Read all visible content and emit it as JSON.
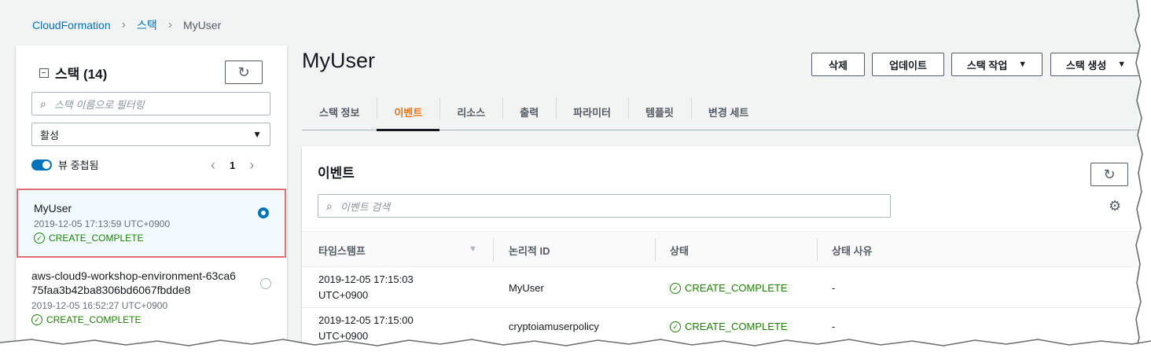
{
  "breadcrumb": {
    "root": "CloudFormation",
    "stacks": "스택",
    "current": "MyUser"
  },
  "left": {
    "title": "스택 (14)",
    "filter_placeholder": "스택 이름으로 필터링",
    "status_filter": "활성",
    "toggle_label": "뷰 중첩됨",
    "page": "1",
    "stacks": [
      {
        "name": "MyUser",
        "time": "2019-12-05 17:13:59 UTC+0900",
        "status": "CREATE_COMPLETE",
        "selected": true
      },
      {
        "name": "aws-cloud9-workshop-environment-63ca675faa3b42ba8306bd6067fbdde8",
        "name_line1": "aws-cloud9-workshop-environment-63ca6",
        "name_line2": "75faa3b42ba8306bd6067fbdde8",
        "time": "2019-12-05 16:52:27 UTC+0900",
        "status": "CREATE_COMPLETE",
        "selected": false
      }
    ]
  },
  "main": {
    "title": "MyUser",
    "buttons": {
      "delete": "삭제",
      "update": "업데이트",
      "stack_actions": "스택 작업",
      "create_stack": "스택 생성"
    },
    "tabs": [
      "스택 정보",
      "이벤트",
      "리소스",
      "출력",
      "파라미터",
      "템플릿",
      "변경 세트"
    ],
    "active_tab": "이벤트",
    "events": {
      "title": "이벤트",
      "search_placeholder": "이벤트 검색",
      "columns": [
        "타임스탬프",
        "논리적 ID",
        "상태",
        "상태 사유"
      ],
      "rows": [
        {
          "ts_line1": "2019-12-05 17:15:03",
          "ts_line2": "UTC+0900",
          "logical_id": "MyUser",
          "status": "CREATE_COMPLETE",
          "reason": "-"
        },
        {
          "ts_line1": "2019-12-05 17:15:00",
          "ts_line2": "UTC+0900",
          "logical_id": "cryptoiamuserpolicy",
          "status": "CREATE_COMPLETE",
          "reason": "-"
        }
      ]
    }
  },
  "colors": {
    "link": "#0073bb",
    "accent_tab": "#ec7211",
    "success": "#1d8102",
    "selected_outline": "#e07070"
  },
  "icons": [
    "refresh-icon",
    "search-icon",
    "caret-down-icon",
    "chevron-left-icon",
    "chevron-right-icon",
    "check-circle-icon",
    "gear-icon",
    "collapse-icon"
  ]
}
